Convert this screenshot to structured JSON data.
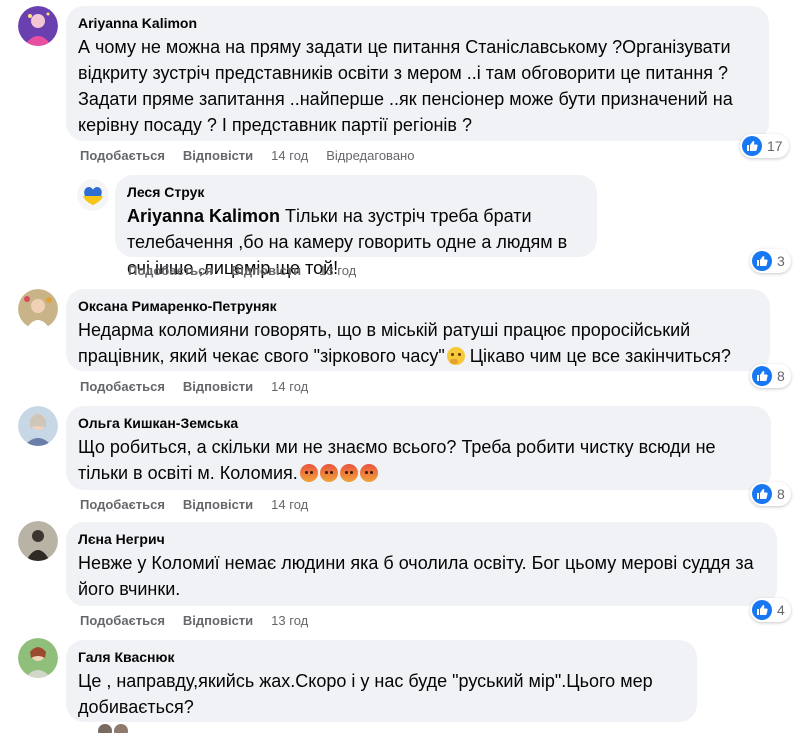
{
  "colors": {
    "bubble": "#f0f2f5",
    "meta_text": "#65676b",
    "like_blue": "#1877f2"
  },
  "comments": [
    {
      "author": "Ariyanna Kalimon",
      "text": "А чому не можна на пряму задати це питання Станіславському ?Організувати відкриту зустріч представників освіти з мером ..і там обговорити це питання ? Задати пряме запитання ..найперше ..як пенсіонер може бути призначений на керівну посаду ? І представник партії регіонів ?",
      "like_label": "Подобається",
      "reply_label": "Відповісти",
      "time": "14 год",
      "edited": "Відредаговано",
      "reactions": "17",
      "reaction_icon": "like-icon"
    },
    {
      "author": "Леся Струк",
      "mention": "Ariyanna Kalimon",
      "text": " Тільки на зустріч треба брати телебачення ,бо на камеру говорить одне а людям в очі інше ,лицемір ще той!",
      "like_label": "Подобається",
      "reply_label": "Відповісти",
      "time": "13 год",
      "reactions": "3",
      "reaction_icon": "like-icon"
    },
    {
      "author": "Оксана Римаренко-Петруняк",
      "text_a": "Недарма коломияни говорять, що в міській ратуші працює проросійський працівник, який чекає свого \"зіркового часу\"",
      "text_b": " Цікаво чим це все закінчиться?",
      "emoji": "thinking-emoji",
      "like_label": "Подобається",
      "reply_label": "Відповісти",
      "time": "14 год",
      "reactions": "8",
      "reaction_icon": "like-icon"
    },
    {
      "author": "Ольга Кишкан-Земська",
      "text": "Що робиться, а скільки ми не знаємо всього? Треба робити чистку всюди не тільки в освіті м. Коломия.",
      "emoji": "angry-emoji",
      "like_label": "Подобається",
      "reply_label": "Відповісти",
      "time": "14 год",
      "reactions": "8",
      "reaction_icon": "like-icon"
    },
    {
      "author": "Лєна Негрич",
      "text": "Невже у Коломиї немає людини яка б очолила освіту. Бог цьому мерові суддя за його вчинки.",
      "like_label": "Подобається",
      "reply_label": "Відповісти",
      "time": "13 год",
      "reactions": "4",
      "reaction_icon": "like-icon"
    },
    {
      "author": "Галя Кваснюк",
      "text": "Це , направду,якийсь жах.Скоро і у нас буде \"руський мір\".Цього мер добивається?"
    }
  ]
}
